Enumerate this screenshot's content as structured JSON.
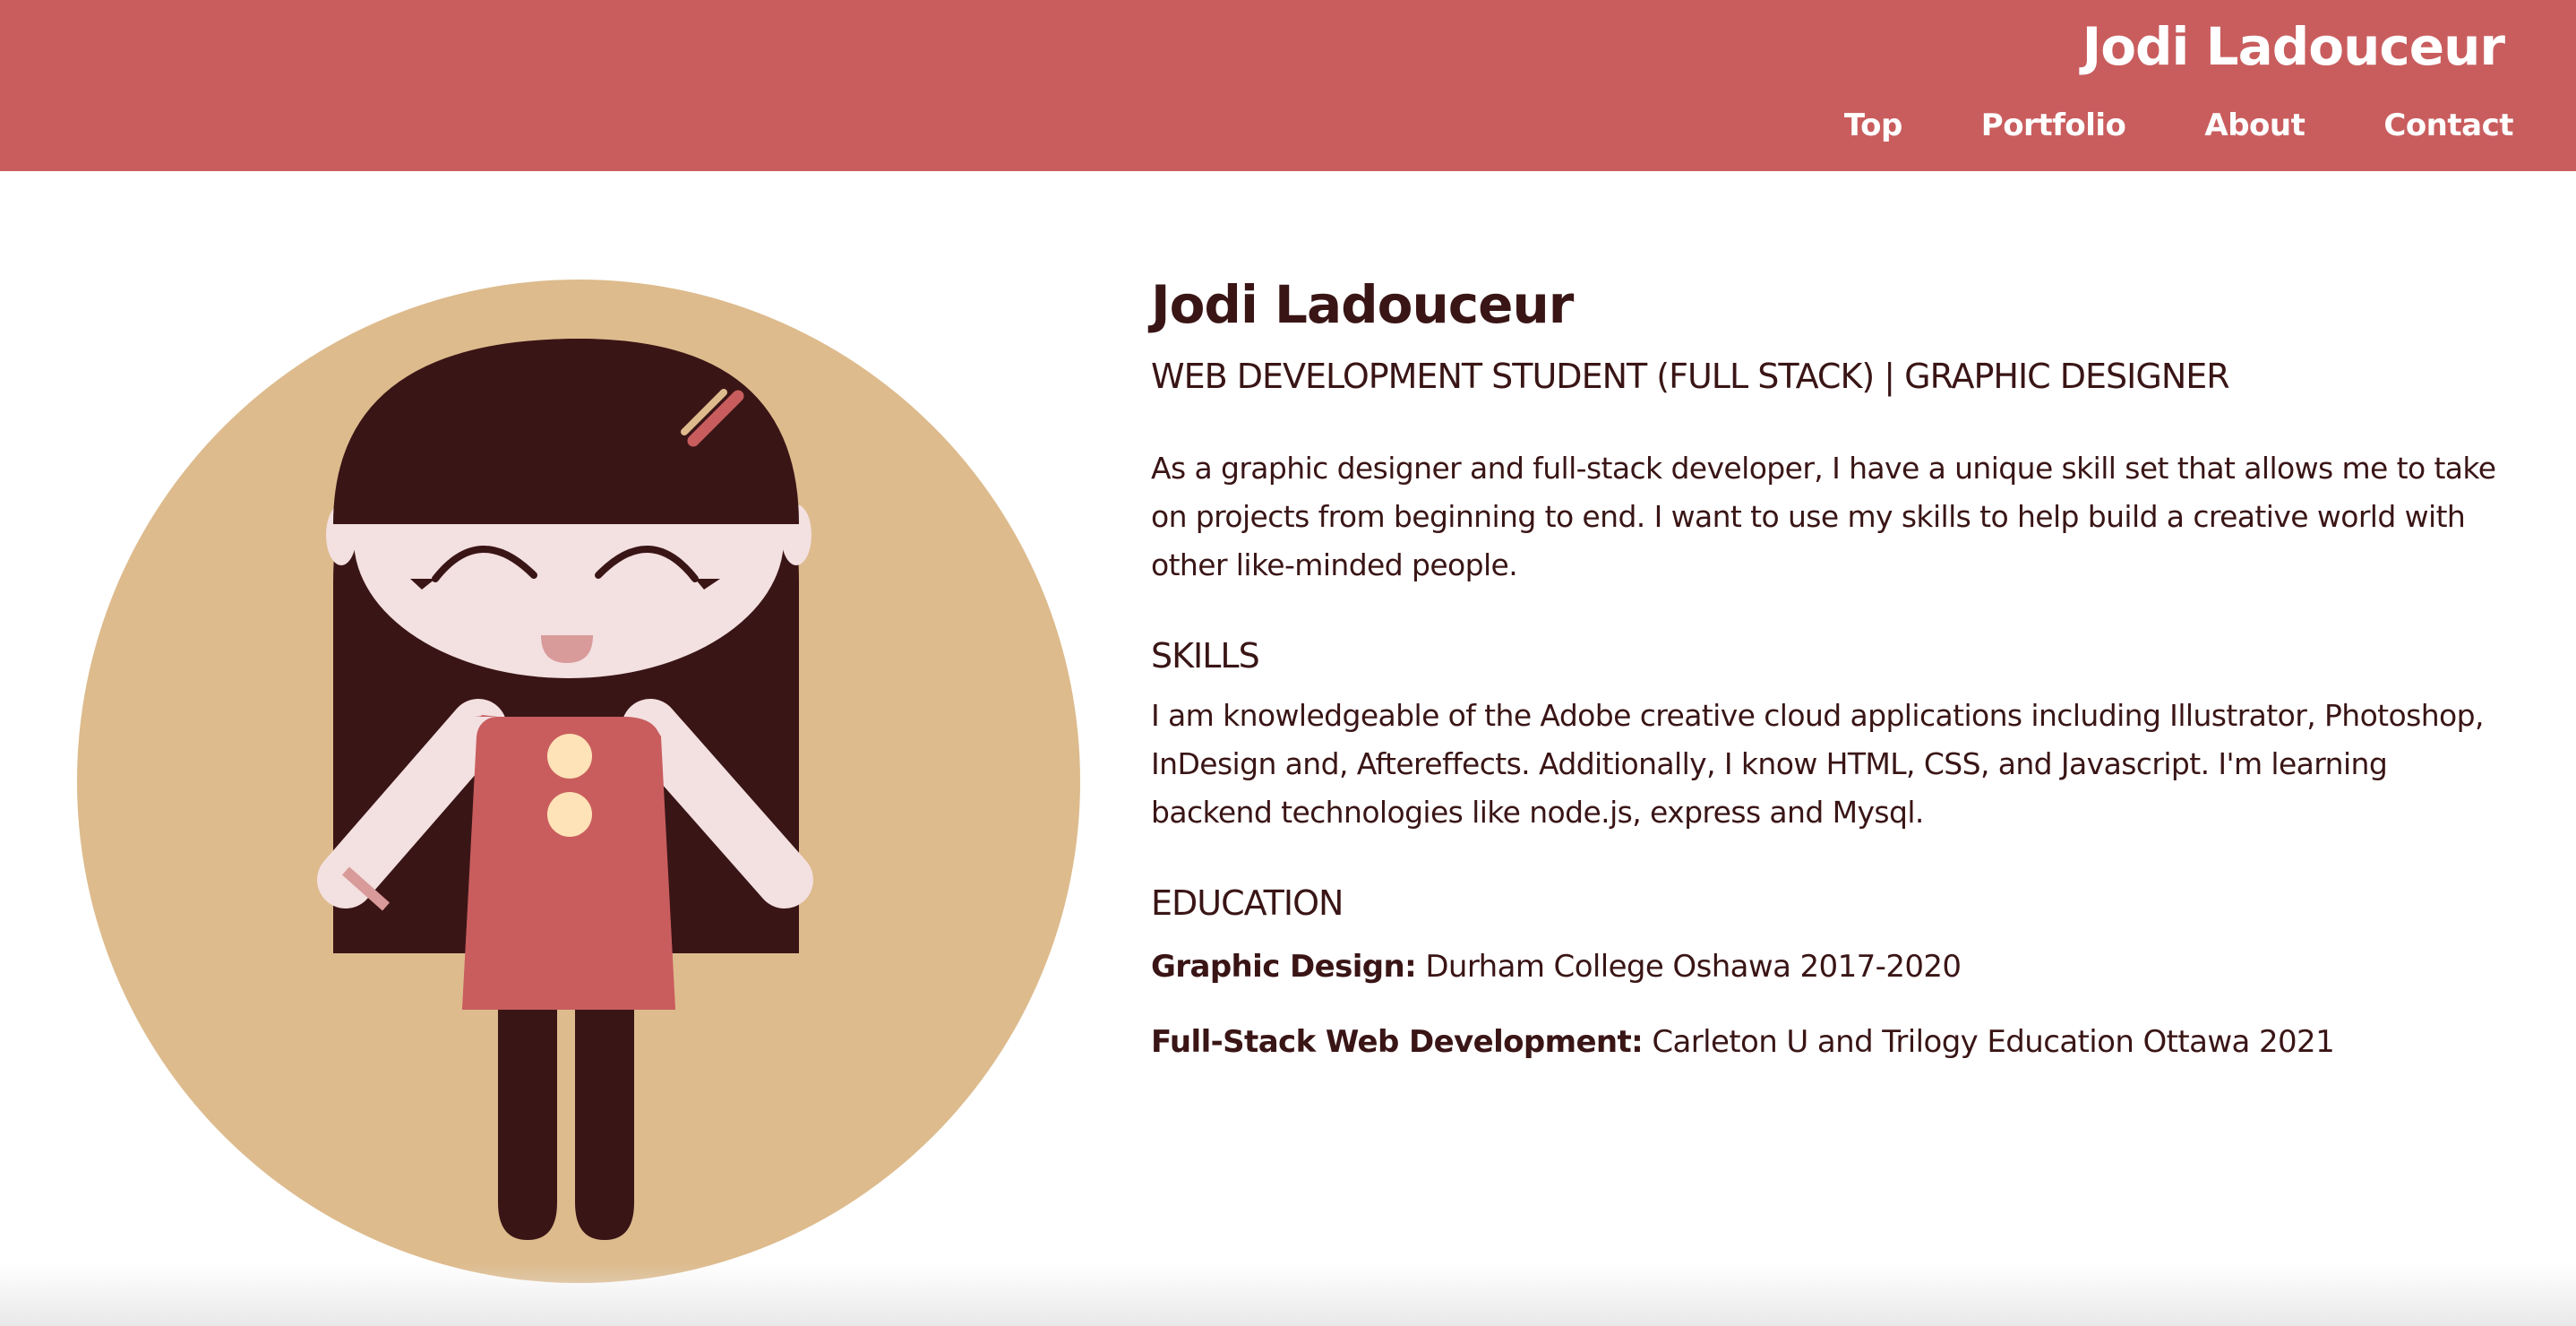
{
  "header": {
    "site_title": "Jodi Ladouceur",
    "nav": [
      "Top",
      "Portfolio",
      "About",
      "Contact"
    ]
  },
  "profile": {
    "name": "Jodi Ladouceur",
    "subtitle": "WEB DEVELOPMENT STUDENT (FULL STACK) | GRAPHIC DESIGNER",
    "intro": "As a graphic designer and full-stack developer, I have a unique skill set that allows me to take on projects from beginning to end. I want to use my skills to help build a creative world with other like-minded people."
  },
  "skills": {
    "heading": "SKILLS",
    "text": "I am knowledgeable of the Adobe creative cloud applications including Illustrator, Photoshop, InDesign and, Aftereffects. Additionally, I know HTML, CSS, and Javascript. I'm learning backend technologies like node.js, express and Mysql."
  },
  "education": {
    "heading": "EDUCATION",
    "items": [
      {
        "label": "Graphic Design:",
        "detail": " Durham College Oshawa 2017-2020"
      },
      {
        "label": "Full-Stack Web Development:",
        "detail": " Carleton U and Trilogy Education Ottawa 2021"
      }
    ]
  },
  "colors": {
    "header_bg": "#c95d5e",
    "text_dark": "#3a1516",
    "avatar_circle": "#ddbb8d",
    "skin": "#f3e0e1",
    "dress": "#c95d5e",
    "buttons": "#fde3b7"
  },
  "avatar": {
    "icon": "girl-illustration-avatar"
  }
}
